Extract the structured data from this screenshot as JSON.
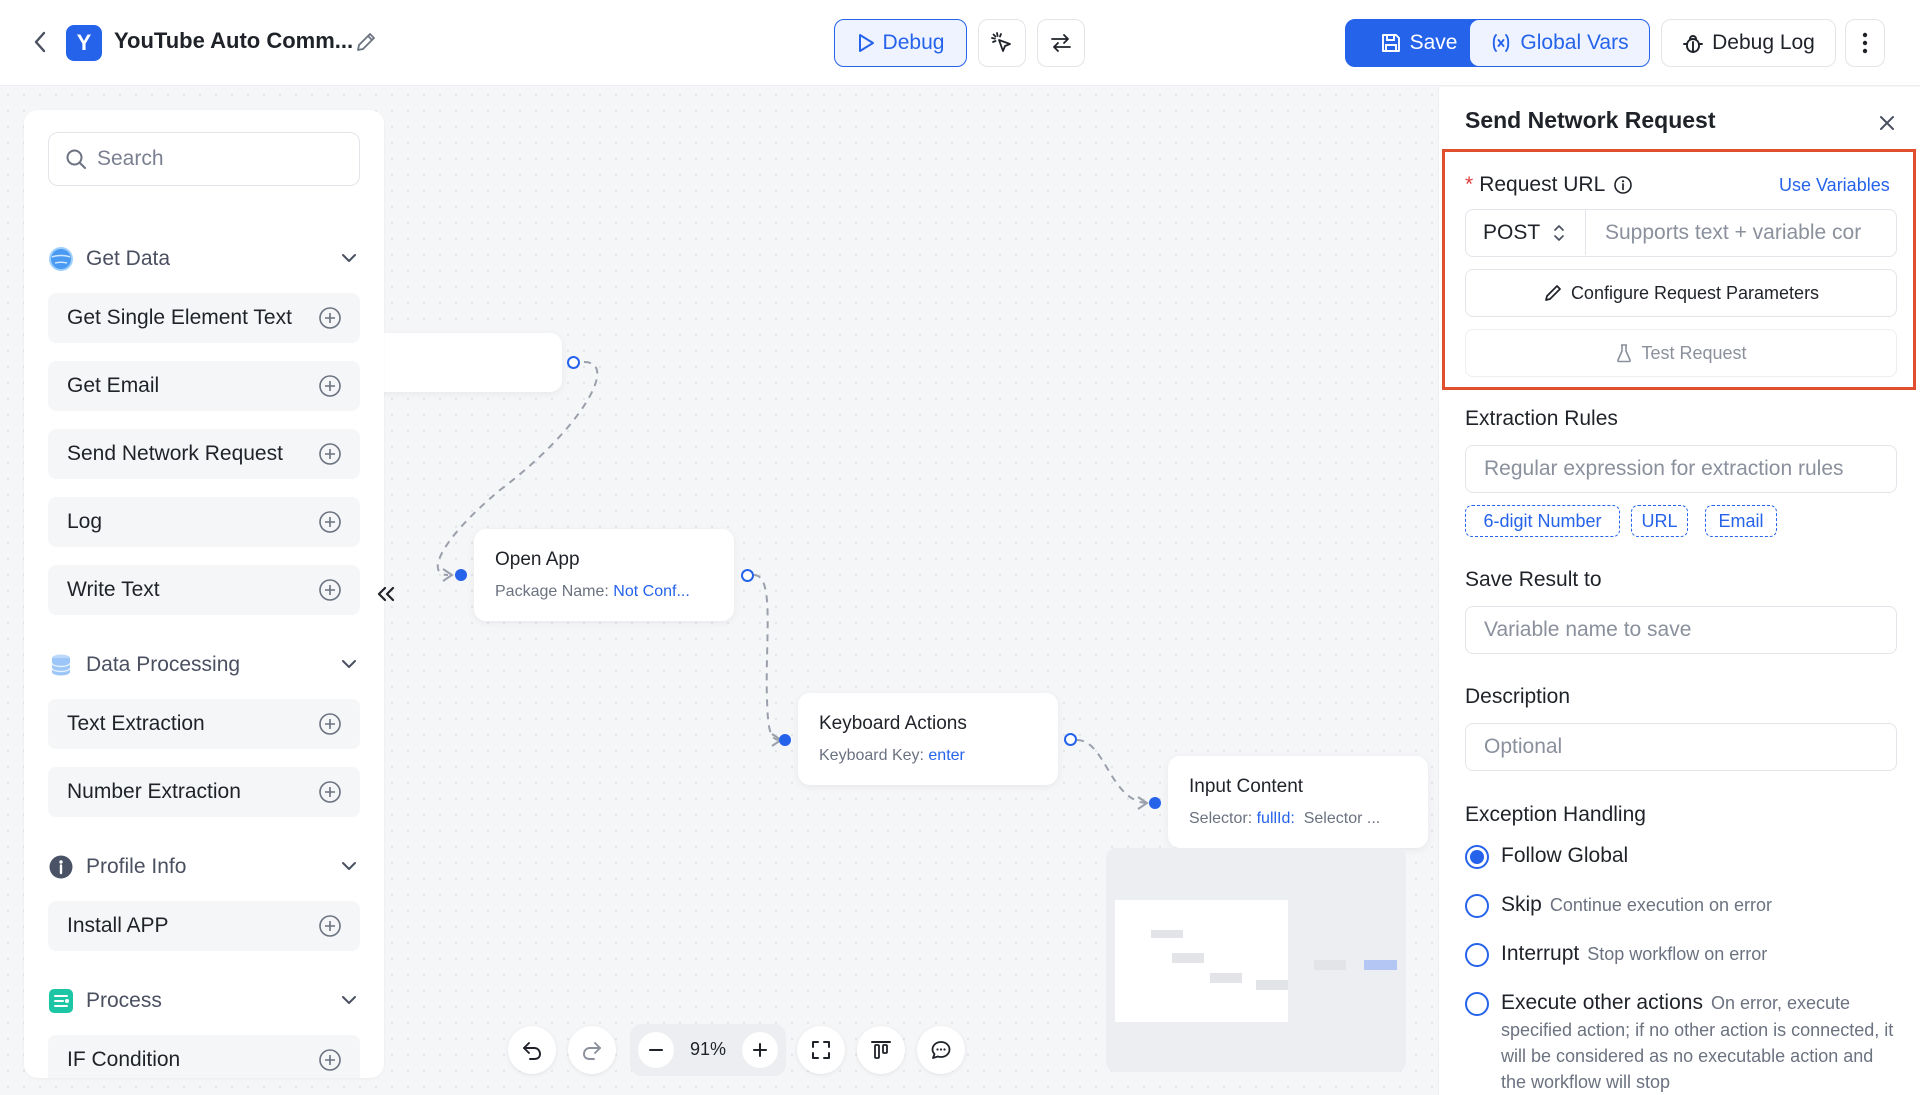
{
  "header": {
    "title": "YouTube Auto Comm...",
    "logo_letter": "Y",
    "debug_label": "Debug",
    "save_label": "Save",
    "global_vars_label": "Global Vars",
    "debug_log_label": "Debug Log"
  },
  "sidebar": {
    "search_placeholder": "Search",
    "categories": [
      {
        "label": "Get Data",
        "icon": "globe-icon",
        "items": [
          "Get Single Element Text",
          "Get Email",
          "Send Network Request",
          "Log",
          "Write Text"
        ]
      },
      {
        "label": "Data Processing",
        "icon": "database-icon",
        "items": [
          "Text Extraction",
          "Number Extraction"
        ]
      },
      {
        "label": "Profile Info",
        "icon": "info-icon",
        "items": [
          "Install APP"
        ]
      },
      {
        "label": "Process",
        "icon": "process-icon",
        "items": [
          "IF Condition"
        ]
      }
    ]
  },
  "canvas": {
    "nodes": [
      {
        "title": "Open App",
        "sub_label": "Package Name:",
        "sub_value": "Not Conf..."
      },
      {
        "title": "Keyboard Actions",
        "sub_label": "Keyboard Key:",
        "sub_value": "enter"
      },
      {
        "title": "Input Content",
        "sub_label": "Selector:",
        "sub_value": "fullId:",
        "sub_extra": "Selector ..."
      }
    ],
    "zoom": "91%"
  },
  "panel": {
    "title": "Send Network Request",
    "request_url_label": "Request URL",
    "use_variables": "Use Variables",
    "method": "POST",
    "url_placeholder": "Supports text + variable cor",
    "configure_label": "Configure Request Parameters",
    "test_label": "Test Request",
    "extraction_label": "Extraction Rules",
    "extraction_placeholder": "Regular expression for extraction rules",
    "tags": [
      "6-digit Number",
      "URL",
      "Email"
    ],
    "save_result_label": "Save Result to",
    "save_placeholder": "Variable name to save",
    "description_label": "Description",
    "description_placeholder": "Optional",
    "exception_label": "Exception Handling",
    "options": [
      {
        "label": "Follow Global",
        "hint": "",
        "selected": true
      },
      {
        "label": "Skip",
        "hint": "Continue execution on error",
        "selected": false
      },
      {
        "label": "Interrupt",
        "hint": "Stop workflow on error",
        "selected": false
      },
      {
        "label": "Execute other actions",
        "hint": "On error, execute",
        "selected": false
      }
    ],
    "execute_desc": "specified action; if no other action is connected, it will be considered as no executable action and the workflow will stop"
  },
  "colors": {
    "accent": "#2563eb",
    "highlight_border": "#e0502e"
  }
}
